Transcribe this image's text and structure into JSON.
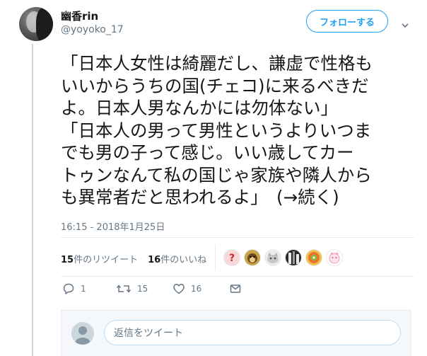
{
  "user": {
    "display_name": "幽香rin",
    "handle": "@yoyoko_17"
  },
  "follow_button_label": "フォローする",
  "tweet": {
    "lines": [
      "「日本人女性は綺麗だし、謙虚で性格も",
      "いいからうちの国(チェコ)に来るべきだ",
      "よ。日本人男なんかには勿体ない」",
      "「日本人の男って男性というよりいつま",
      "でも男の子って感じ。いい歳してカー",
      "トゥンなんて私の国じゃ家族や隣人から",
      "も異常者だと思われるよ」　(→続く)"
    ],
    "timestamp": "16:15 - 2018年1月25日"
  },
  "stats": {
    "retweet_count": "15",
    "retweet_label": "件のリツイート",
    "like_count": "16",
    "like_label": "件のいいね"
  },
  "liker_avatars": [
    "question-avatar",
    "monkey-avatar",
    "cat-avatar",
    "building-avatar",
    "food-avatar",
    "pink-char-avatar"
  ],
  "actions": {
    "reply_count": "1",
    "retweet_count": "15",
    "like_count": "16"
  },
  "reply_box": {
    "placeholder": "返信をツイート"
  },
  "colors": {
    "accent": "#1da1f2",
    "muted": "#657786",
    "text": "#14171a"
  }
}
